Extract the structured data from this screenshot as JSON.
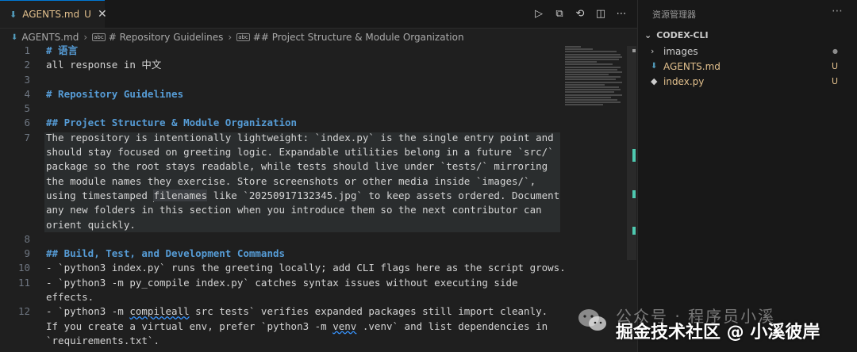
{
  "tab": {
    "label": "AGENTS.md",
    "badge": "U",
    "close": "✕"
  },
  "tab_actions": [
    "▷",
    "⧉",
    "⟲",
    "◫",
    "⋯"
  ],
  "breadcrumb": {
    "file": "AGENTS.md",
    "h1": "# Repository Guidelines",
    "h2": "## Project Structure & Module Organization"
  },
  "code": {
    "line_numbers": [
      "1",
      "2",
      "3",
      "4",
      "5",
      "6",
      "7",
      "",
      "",
      "",
      "",
      "",
      "",
      "8",
      "9",
      "10",
      "11",
      "",
      "12",
      "",
      ""
    ],
    "lines": [
      "# 语言",
      "all response in 中文",
      "",
      "# Repository Guidelines",
      "",
      "## Project Structure & Module Organization",
      "The repository is intentionally lightweight: `index.py` is the single entry point and",
      "should stay focused on greeting logic. Expandable utilities belong in a future `src/`",
      "package so the root stays readable, while tests should live under `tests/` mirroring",
      "the module names they exercise. Store screenshots or other media inside `images/`,",
      "using timestamped ",
      "any new folders in this section when you introduce them so the next contributor can",
      "orient quickly.",
      "",
      "## Build, Test, and Development Commands",
      "- `python3 index.py` runs the greeting locally; add CLI flags here as the script grows.",
      "- `python3 -m py_compile index.py` catches syntax issues without executing side",
      "effects.",
      "- `python3 -m ",
      "If you create a virtual env, prefer `python3 -m ",
      "`requirements.txt`."
    ],
    "line11_word": "filenames",
    "line11_rest": " like `20250917132345.jpg` to keep assets ordered. Document",
    "line12_word": "compileall",
    "line12_rest": " src tests` verifies expanded packages still import cleanly.",
    "line12b_word": "venv",
    "line12b_rest": " .venv` and list dependencies in"
  },
  "explorer": {
    "title": "资源管理器",
    "more": "⋯",
    "folder": "CODEX-CLI",
    "items": [
      {
        "name": "images",
        "badge": "●",
        "color": "#cccccc"
      },
      {
        "name": "AGENTS.md",
        "badge": "U",
        "color": "#e2c08d"
      },
      {
        "name": "index.py",
        "badge": "U",
        "color": "#e2c08d"
      }
    ]
  },
  "watermark": {
    "channel": "公众号 · 程序员小溪",
    "site": "掘金技术社区 @ 小溪彼岸"
  },
  "colors": {
    "accent": "#0078d4",
    "untracked": "#e2c08d",
    "heading": "#569cd6",
    "scroll_mark": "#4ec9b0"
  }
}
